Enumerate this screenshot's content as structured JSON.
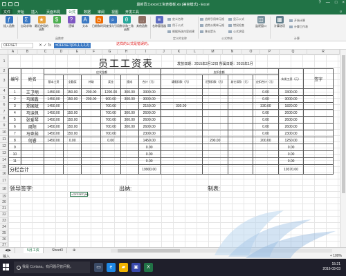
{
  "window": {
    "title": "最新员工excel工资表模板.xls [兼容模式] - Excel",
    "controls": [
      "?",
      "—",
      "□",
      "×"
    ]
  },
  "ribbon_tabs": [
    "文件",
    "开始",
    "插入",
    "页面布局",
    "公式",
    "数据",
    "审阅",
    "视图",
    "开发工具"
  ],
  "active_tab": "公式",
  "ribbon": {
    "buttons": [
      {
        "label": "插入函数",
        "icon": "insert-function-icon",
        "color": "#3a78c3",
        "glyph": "fx"
      },
      {
        "label": "自动求和",
        "icon": "autosum-icon",
        "color": "#3a78c3",
        "glyph": "Σ"
      },
      {
        "label": "最近使用的函数",
        "icon": "recent-functions-icon",
        "color": "#e6a23c",
        "glyph": "★"
      },
      {
        "label": "财务",
        "icon": "financial-icon",
        "color": "#4caf50",
        "glyph": "$"
      },
      {
        "label": "逻辑",
        "icon": "logical-icon",
        "color": "#7e57c2",
        "glyph": "?"
      },
      {
        "label": "文本",
        "icon": "text-icon",
        "color": "#3a78c3",
        "glyph": "A"
      },
      {
        "label": "日期和时间",
        "icon": "datetime-icon",
        "color": "#ef6c00",
        "glyph": "◷"
      },
      {
        "label": "查找与引用",
        "icon": "lookup-icon",
        "color": "#3a78c3",
        "glyph": "⌕"
      },
      {
        "label": "数学和三角函数",
        "icon": "math-icon",
        "color": "#26a69a",
        "glyph": "θ"
      },
      {
        "label": "其他函数",
        "icon": "more-functions-icon",
        "color": "#8d6e63",
        "glyph": "…"
      },
      {
        "label": "名称管理器",
        "icon": "name-manager-icon",
        "color": "#5c6bc0",
        "glyph": "≡"
      }
    ],
    "defined_names": [
      "定义名称",
      "用于公式",
      "根据所选内容创建"
    ],
    "auditing": [
      "追踪引用单元格",
      "追踪从属单元格",
      "移去箭头",
      "显示公式",
      "错误检查",
      "公式求值"
    ],
    "watch": "监视窗口",
    "calc_options": "计算选项",
    "calc_items": [
      "开始计算",
      "计算工作表"
    ],
    "groups": [
      "函数库",
      "定义的名称",
      "公式审核",
      "计算"
    ]
  },
  "formula_bar": {
    "name_box": "OFFSET",
    "formula": "=OFFSET(D3,1,1,2,2)",
    "callout": "这样的公式是错误的。"
  },
  "columns": [
    "A",
    "B",
    "C",
    "D",
    "E",
    "F",
    "G",
    "H",
    "I",
    "J",
    "K",
    "L",
    "M",
    "N",
    "O",
    "P",
    "Q",
    "R"
  ],
  "rows": [
    "1",
    "2",
    "3",
    "4",
    "5",
    "6",
    "7",
    "8",
    "9",
    "10",
    "11",
    "12",
    "13",
    "14",
    "15",
    "16",
    "17",
    "18",
    "19",
    "20",
    "21",
    "22",
    "23",
    "24",
    "25",
    "26",
    "27",
    "28",
    "29",
    "30",
    "31",
    "32"
  ],
  "sheet": {
    "title": "员工工资表",
    "issue_date": "发放日期：2015年2月12日 所属日期：2015年1月",
    "headers": {
      "no": "编号",
      "name": "姓名",
      "payable": "应发金额",
      "deduct": "应扣金额",
      "actual": "实发工资（元）",
      "sign": "签字",
      "sub": [
        "基本工资",
        "全勤奖",
        "补助",
        "奖金",
        "提成",
        "合计（元）",
        "请假扣款（元）",
        "迟到扣款（元）",
        "其它扣款（元）",
        "应扣合计（元）"
      ]
    },
    "employees": [
      {
        "no": "1",
        "name": "王卫明",
        "vals": [
          "1450.00",
          "150.00",
          "200.00",
          "1200.00",
          "300.00",
          "3300.00",
          "",
          "",
          "",
          "0.00",
          "3300.00"
        ]
      },
      {
        "no": "2",
        "name": "马国鑫",
        "vals": [
          "1450.00",
          "150.00",
          "200.00",
          "900.00",
          "300.00",
          "3000.00",
          "",
          "",
          "",
          "0.00",
          "3000.00"
        ]
      },
      {
        "no": "3",
        "name": "郑国斌",
        "vals": [
          "1450.00",
          "",
          "",
          "700.00",
          "",
          "2150.00",
          "330.00",
          "",
          "",
          "330.00",
          "1820.00"
        ]
      },
      {
        "no": "4",
        "name": "马运佩",
        "vals": [
          "1450.00",
          "150.00",
          "",
          "700.00",
          "300.00",
          "2600.00",
          "",
          "",
          "",
          "0.00",
          "2600.00"
        ]
      },
      {
        "no": "5",
        "name": "张爱琴",
        "vals": [
          "1450.00",
          "150.00",
          "",
          "700.00",
          "300.00",
          "2600.00",
          "",
          "",
          "",
          "0.00",
          "2600.00"
        ]
      },
      {
        "no": "6",
        "name": "周阳",
        "vals": [
          "1450.00",
          "150.00",
          "",
          "700.00",
          "300.00",
          "2600.00",
          "",
          "",
          "",
          "0.00",
          "2600.00"
        ]
      },
      {
        "no": "7",
        "name": "马亚茹",
        "vals": [
          "1450.00",
          "150.00",
          "",
          "700.00",
          "",
          "2300.00",
          "",
          "",
          "",
          "0.00",
          "2300.00"
        ]
      },
      {
        "no": "8",
        "name": "何睿",
        "vals": [
          "1450.00",
          "0.00",
          "",
          "0.00",
          "",
          "1450.00",
          "",
          "200.00",
          "",
          "200.00",
          "1250.00"
        ]
      },
      {
        "no": "9",
        "name": "",
        "vals": [
          "",
          "",
          "",
          "",
          "",
          "0.00",
          "",
          "",
          "",
          "",
          "0.00"
        ]
      },
      {
        "no": "10",
        "name": "",
        "vals": [
          "",
          "",
          "",
          "",
          "",
          "0.00",
          "",
          "",
          "",
          "",
          "0.00"
        ]
      },
      {
        "no": "11",
        "name": "",
        "vals": [
          "",
          "",
          "",
          "",
          "",
          "0.00",
          "",
          "",
          "",
          "",
          "0.00"
        ]
      }
    ],
    "subtotal_label": "分栏合计",
    "subtotal_total": "19900.00",
    "subtotal_actual": "19370.00",
    "sign_leader": "领导签字:",
    "sign_cashier": "出纳:",
    "sign_maker": "制表:",
    "editing_cell": "=OFFSET(A6)"
  },
  "sheet_tabs": [
    "5月工资",
    "Sheet3"
  ],
  "active_sheet": "5月工资",
  "status": {
    "left": "输入",
    "right": "+ 100%"
  },
  "taskbar": {
    "search": "我是 Cortana。有问题尽管问我。",
    "time": "15:21",
    "date": "2016-03-03"
  }
}
